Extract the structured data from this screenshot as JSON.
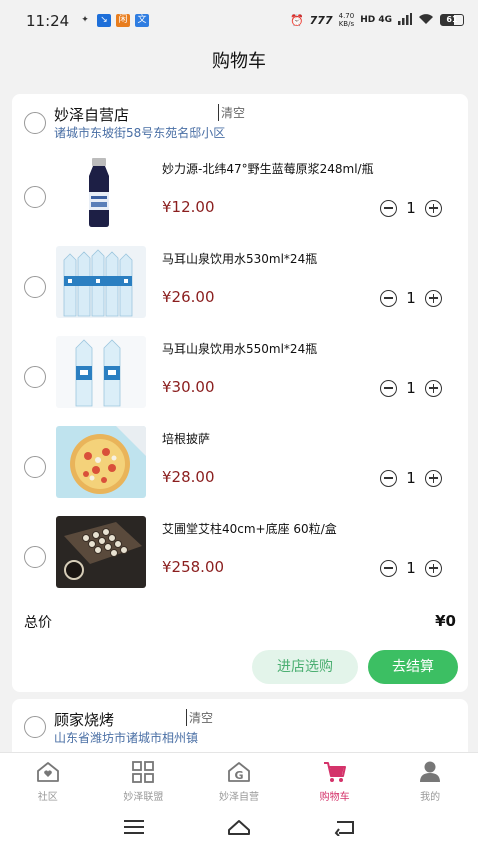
{
  "status_bar": {
    "time": "11:24",
    "speed": "4.70\nKB/s",
    "net": "HD 4G",
    "battery": "61"
  },
  "title": "购物车",
  "stores": [
    {
      "name": "妙泽自营店",
      "clear_label": "清空",
      "address": "诸城市东坡街58号东苑名邸小区",
      "items": [
        {
          "title": "妙力源-北纬47°野生蓝莓原浆248ml/瓶",
          "price": "¥12.00",
          "qty": "1",
          "image": "blueberry-juice-bottle"
        },
        {
          "title": "马耳山泉饮用水530ml*24瓶",
          "price": "¥26.00",
          "qty": "1",
          "image": "water-bottles"
        },
        {
          "title": "马耳山泉饮用水550ml*24瓶",
          "price": "¥30.00",
          "qty": "1",
          "image": "water-bottles"
        },
        {
          "title": "培根披萨",
          "price": "¥28.00",
          "qty": "1",
          "image": "bacon-pizza"
        },
        {
          "title": "艾圃堂艾柱40cm+底座 60粒/盒",
          "price": "¥258.00",
          "qty": "1",
          "image": "moxa-box"
        }
      ],
      "total_label": "总价",
      "total_value": "¥0",
      "visit_store_label": "进店选购",
      "checkout_label": "去结算"
    },
    {
      "name": "顾家烧烤",
      "clear_label": "清空",
      "address": "山东省潍坊市诸城市相州镇"
    }
  ],
  "tabs": [
    {
      "label": "社区",
      "icon": "home-heart-icon"
    },
    {
      "label": "妙泽联盟",
      "icon": "grid-icon"
    },
    {
      "label": "妙泽自营",
      "icon": "store-g-icon"
    },
    {
      "label": "购物车",
      "icon": "cart-icon",
      "active": true
    },
    {
      "label": "我的",
      "icon": "user-icon"
    }
  ],
  "colors": {
    "price": "#8b1e1e",
    "accent_green": "#3cbf63",
    "address_blue": "#4a6fa5",
    "active_tab": "#d4336a"
  }
}
